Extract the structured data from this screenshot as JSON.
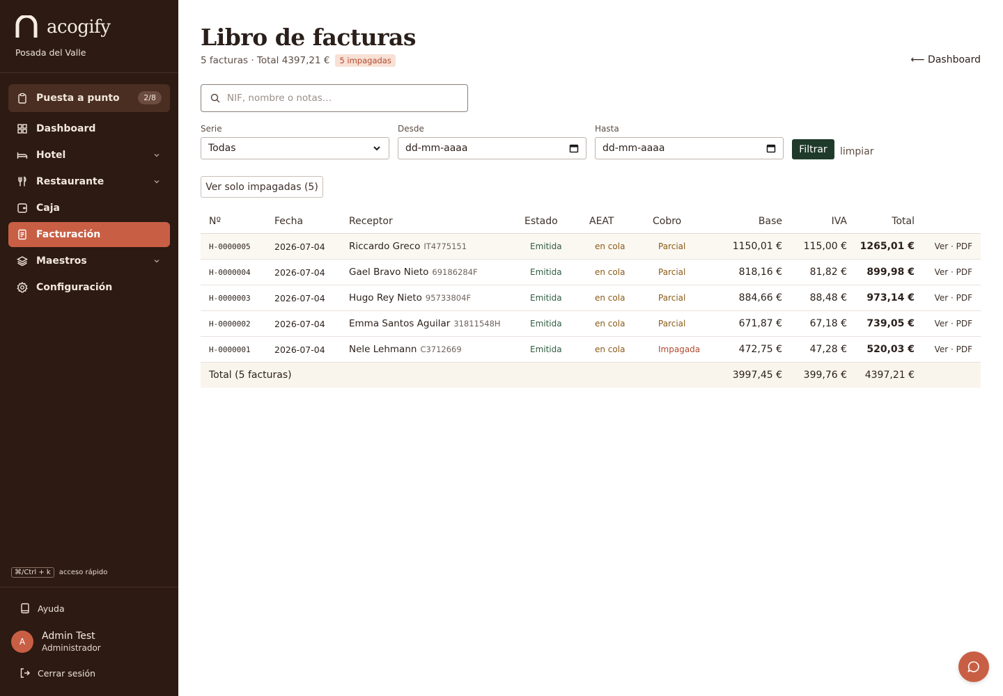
{
  "brand": {
    "name": "acogify",
    "property": "Posada del Valle"
  },
  "sidebar": {
    "setup": {
      "label": "Puesta a punto",
      "count": "2/8"
    },
    "items": [
      {
        "label": "Dashboard",
        "icon": "grid-icon"
      },
      {
        "label": "Hotel",
        "icon": "bed-icon",
        "expandable": true
      },
      {
        "label": "Restaurante",
        "icon": "cutlery-icon",
        "expandable": true
      },
      {
        "label": "Caja",
        "icon": "wallet-icon"
      },
      {
        "label": "Facturación",
        "icon": "invoice-icon",
        "active": true
      },
      {
        "label": "Maestros",
        "icon": "layers-icon",
        "expandable": true
      },
      {
        "label": "Configuración",
        "icon": "gear-icon"
      }
    ],
    "shortcut": {
      "key": "⌘/Ctrl + k",
      "label": "acceso rápido"
    },
    "help": "Ayuda",
    "user": {
      "initial": "A",
      "name": "Admin Test",
      "role": "Administrador"
    },
    "logout": "Cerrar sesión"
  },
  "page": {
    "title": "Libro de facturas",
    "summary": "5 facturas · Total 4397,21 €",
    "unpaid_badge": "5 impagadas",
    "back_link": "⟵ Dashboard"
  },
  "search": {
    "placeholder": "NIF, nombre o notas…",
    "value": ""
  },
  "filters": {
    "serie": {
      "label": "Serie",
      "value": "Todas"
    },
    "desde": {
      "label": "Desde",
      "value": "dd-mm-aaaa"
    },
    "hasta": {
      "label": "Hasta",
      "value": "dd-mm-aaaa"
    },
    "filter_button": "Filtrar",
    "clear_link": "limpiar",
    "unpaid_toggle": "Ver solo impagadas (5)"
  },
  "table": {
    "headers": {
      "number": "Nº",
      "date": "Fecha",
      "receiver": "Receptor",
      "status": "Estado",
      "aeat": "AEAT",
      "payment": "Cobro",
      "base": "Base",
      "iva": "IVA",
      "total": "Total"
    },
    "rows": [
      {
        "number": "H-0000005",
        "date": "2026-07-04",
        "receiver": "Riccardo Greco",
        "nif": "IT4775151",
        "status": "Emitida",
        "aeat": "en cola",
        "payment": "Parcial",
        "base": "1150,01 €",
        "iva": "115,00 €",
        "total": "1265,01 €",
        "view": "Ver",
        "pdf": "PDF"
      },
      {
        "number": "H-0000004",
        "date": "2026-07-04",
        "receiver": "Gael Bravo Nieto",
        "nif": "69186284F",
        "status": "Emitida",
        "aeat": "en cola",
        "payment": "Parcial",
        "base": "818,16 €",
        "iva": "81,82 €",
        "total": "899,98 €",
        "view": "Ver",
        "pdf": "PDF"
      },
      {
        "number": "H-0000003",
        "date": "2026-07-04",
        "receiver": "Hugo Rey Nieto",
        "nif": "95733804F",
        "status": "Emitida",
        "aeat": "en cola",
        "payment": "Parcial",
        "base": "884,66 €",
        "iva": "88,48 €",
        "total": "973,14 €",
        "view": "Ver",
        "pdf": "PDF"
      },
      {
        "number": "H-0000002",
        "date": "2026-07-04",
        "receiver": "Emma Santos Aguilar",
        "nif": "31811548H",
        "status": "Emitida",
        "aeat": "en cola",
        "payment": "Parcial",
        "base": "671,87 €",
        "iva": "67,18 €",
        "total": "739,05 €",
        "view": "Ver",
        "pdf": "PDF"
      },
      {
        "number": "H-0000001",
        "date": "2026-07-04",
        "receiver": "Nele Lehmann",
        "nif": "C3712669",
        "status": "Emitida",
        "aeat": "en cola",
        "payment": "Impagada",
        "base": "472,75 €",
        "iva": "47,28 €",
        "total": "520,03 €",
        "view": "Ver",
        "pdf": "PDF"
      }
    ],
    "footer": {
      "label": "Total (5 facturas)",
      "base": "3997,45 €",
      "iva": "399,76 €",
      "total": "4397,21 €"
    }
  },
  "colors": {
    "sidebar_bg": "#2c1a13",
    "accent": "#c85f45",
    "primary_button": "#1f3a2a",
    "status_green": "#2f5b3f",
    "amber": "#8a5a16"
  }
}
